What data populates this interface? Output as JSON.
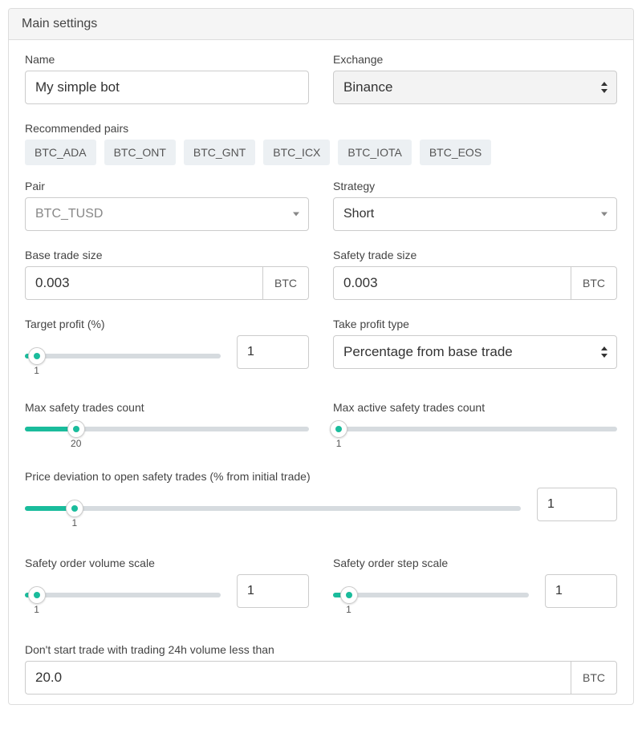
{
  "panel": {
    "title": "Main settings"
  },
  "name": {
    "label": "Name",
    "value": "My simple bot"
  },
  "exchange": {
    "label": "Exchange",
    "value": "Binance"
  },
  "recommended": {
    "label": "Recommended pairs",
    "items": [
      "BTC_ADA",
      "BTC_ONT",
      "BTC_GNT",
      "BTC_ICX",
      "BTC_IOTA",
      "BTC_EOS"
    ]
  },
  "pair": {
    "label": "Pair",
    "value": "BTC_TUSD"
  },
  "strategy": {
    "label": "Strategy",
    "value": "Short"
  },
  "base_trade": {
    "label": "Base trade size",
    "value": "0.003",
    "unit": "BTC"
  },
  "safety_trade": {
    "label": "Safety trade size",
    "value": "0.003",
    "unit": "BTC"
  },
  "target_profit": {
    "label": "Target profit (%)",
    "value": "1",
    "tick": "1",
    "fill_pct": 6,
    "thumb_pct": 6
  },
  "take_profit_type": {
    "label": "Take profit type",
    "value": "Percentage from base trade"
  },
  "max_safety": {
    "label": "Max safety trades count",
    "tick": "20",
    "fill_pct": 18,
    "thumb_pct": 18
  },
  "max_active_safety": {
    "label": "Max active safety trades count",
    "tick": "1",
    "fill_pct": 2,
    "thumb_pct": 2
  },
  "price_dev": {
    "label": "Price deviation to open safety trades (% from initial trade)",
    "value": "1",
    "tick": "1",
    "fill_pct": 10,
    "thumb_pct": 10
  },
  "vol_scale": {
    "label": "Safety order volume scale",
    "value": "1",
    "tick": "1",
    "fill_pct": 6,
    "thumb_pct": 6
  },
  "step_scale": {
    "label": "Safety order step scale",
    "value": "1",
    "tick": "1",
    "fill_pct": 8,
    "thumb_pct": 8
  },
  "min_24h": {
    "label": "Don't start trade with trading 24h volume less than",
    "value": "20.0",
    "unit": "BTC"
  }
}
